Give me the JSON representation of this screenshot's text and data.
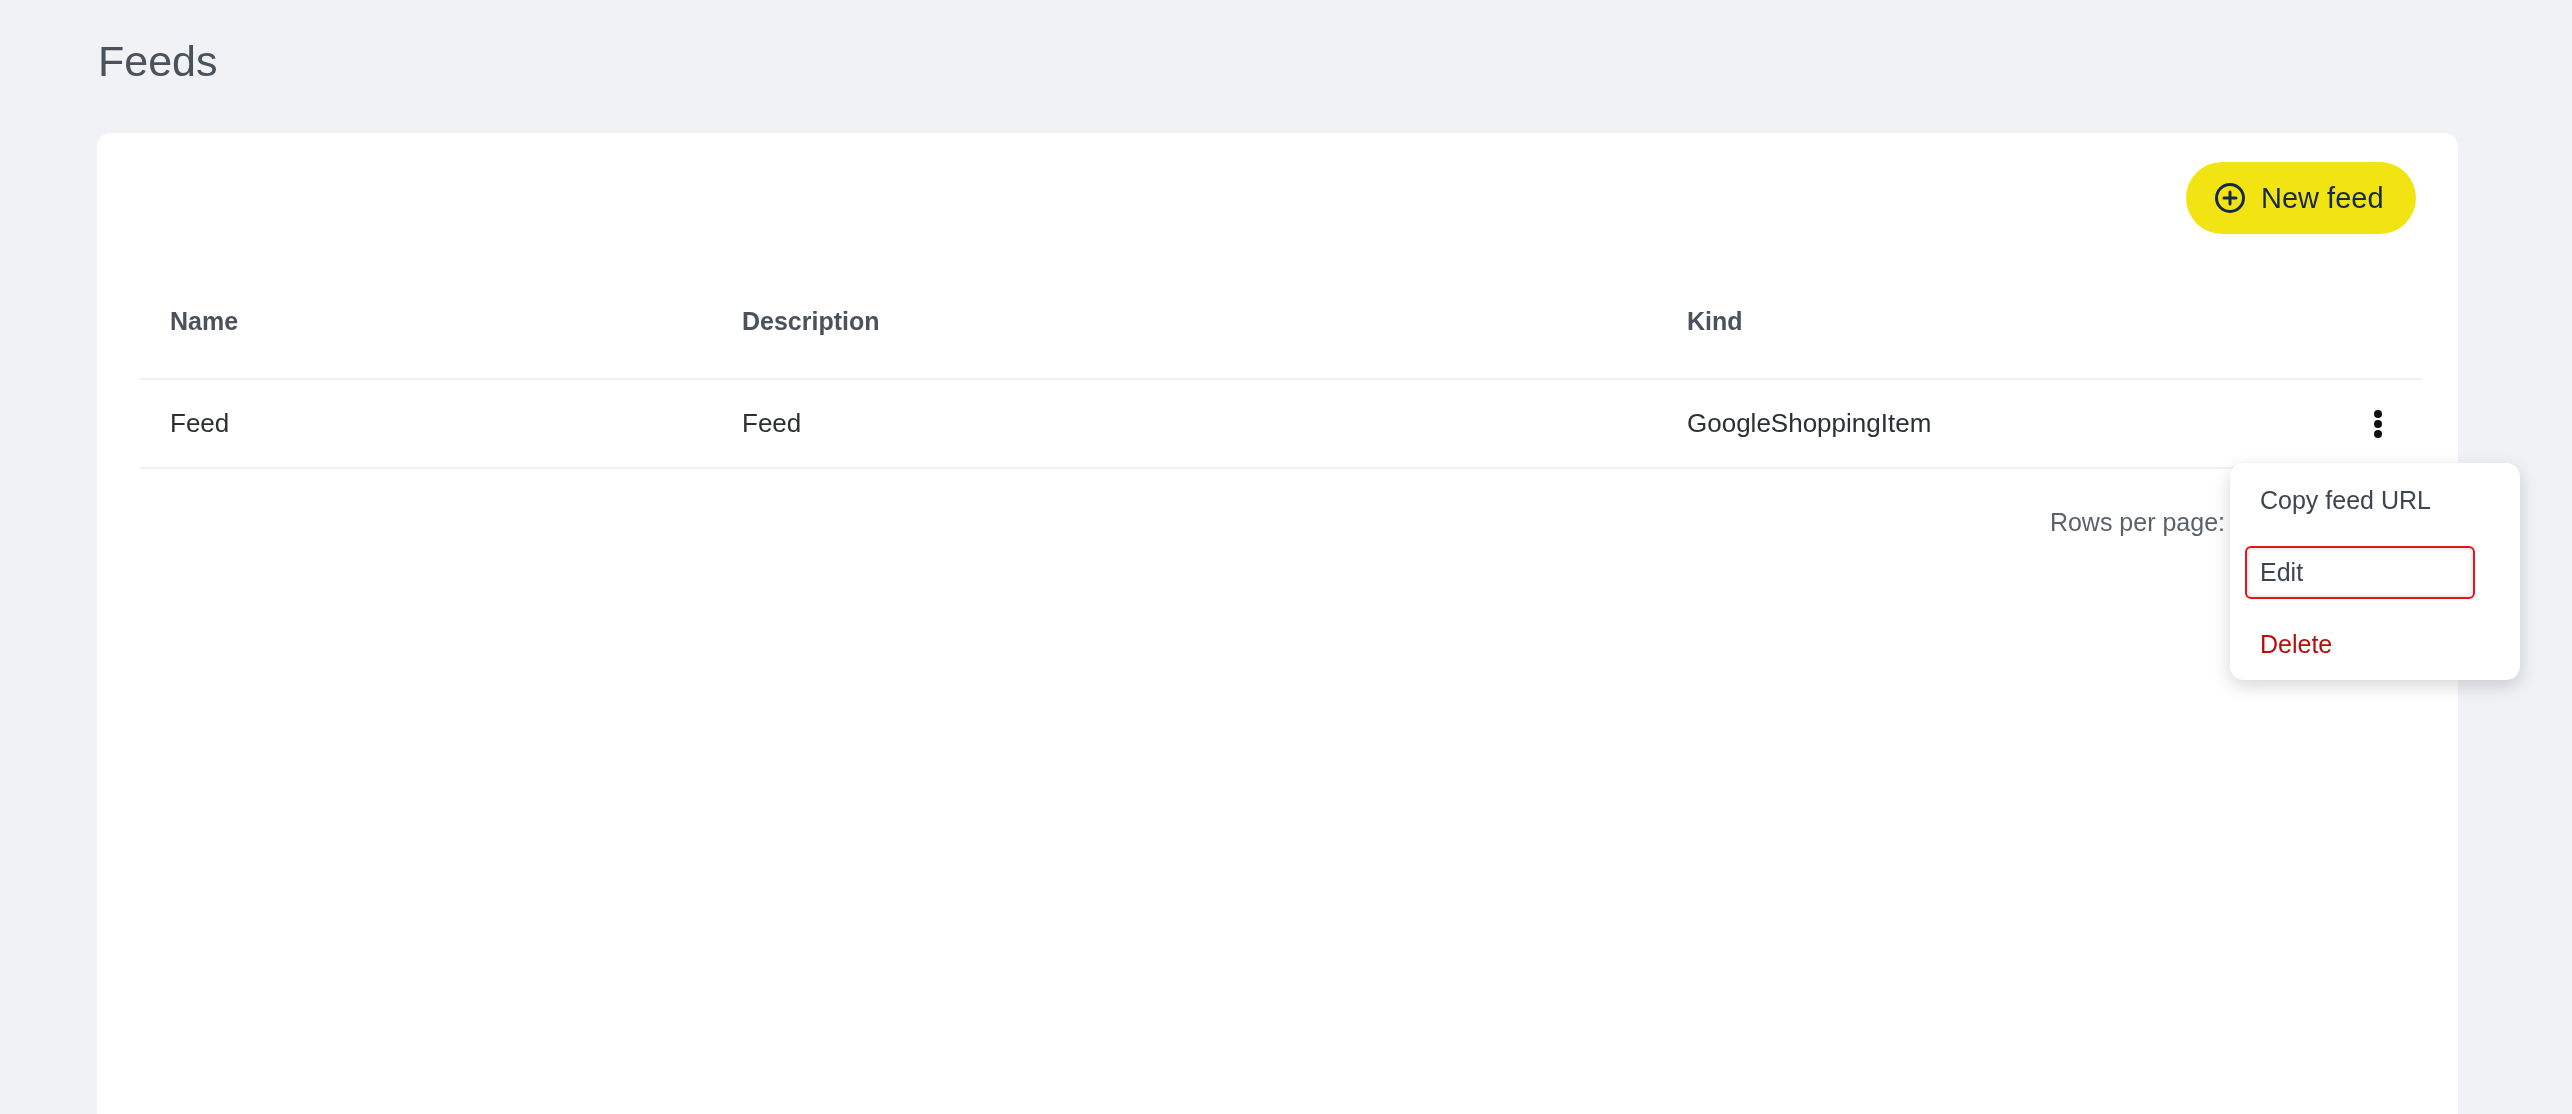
{
  "page": {
    "title": "Feeds"
  },
  "toolbar": {
    "new_button": "New feed"
  },
  "table": {
    "columns": [
      "Name",
      "Description",
      "Kind"
    ],
    "rows": [
      {
        "cells": [
          "Feed",
          "Feed",
          "GoogleShoppingItem"
        ]
      }
    ]
  },
  "pagination": {
    "rows_per_page": "Rows per page:"
  },
  "row_menu": {
    "items": [
      {
        "label": "Copy feed URL",
        "kind": "action",
        "selected": false
      },
      {
        "label": "Edit",
        "kind": "action",
        "selected": true
      },
      {
        "label": "Delete",
        "kind": "danger",
        "selected": false
      }
    ]
  }
}
